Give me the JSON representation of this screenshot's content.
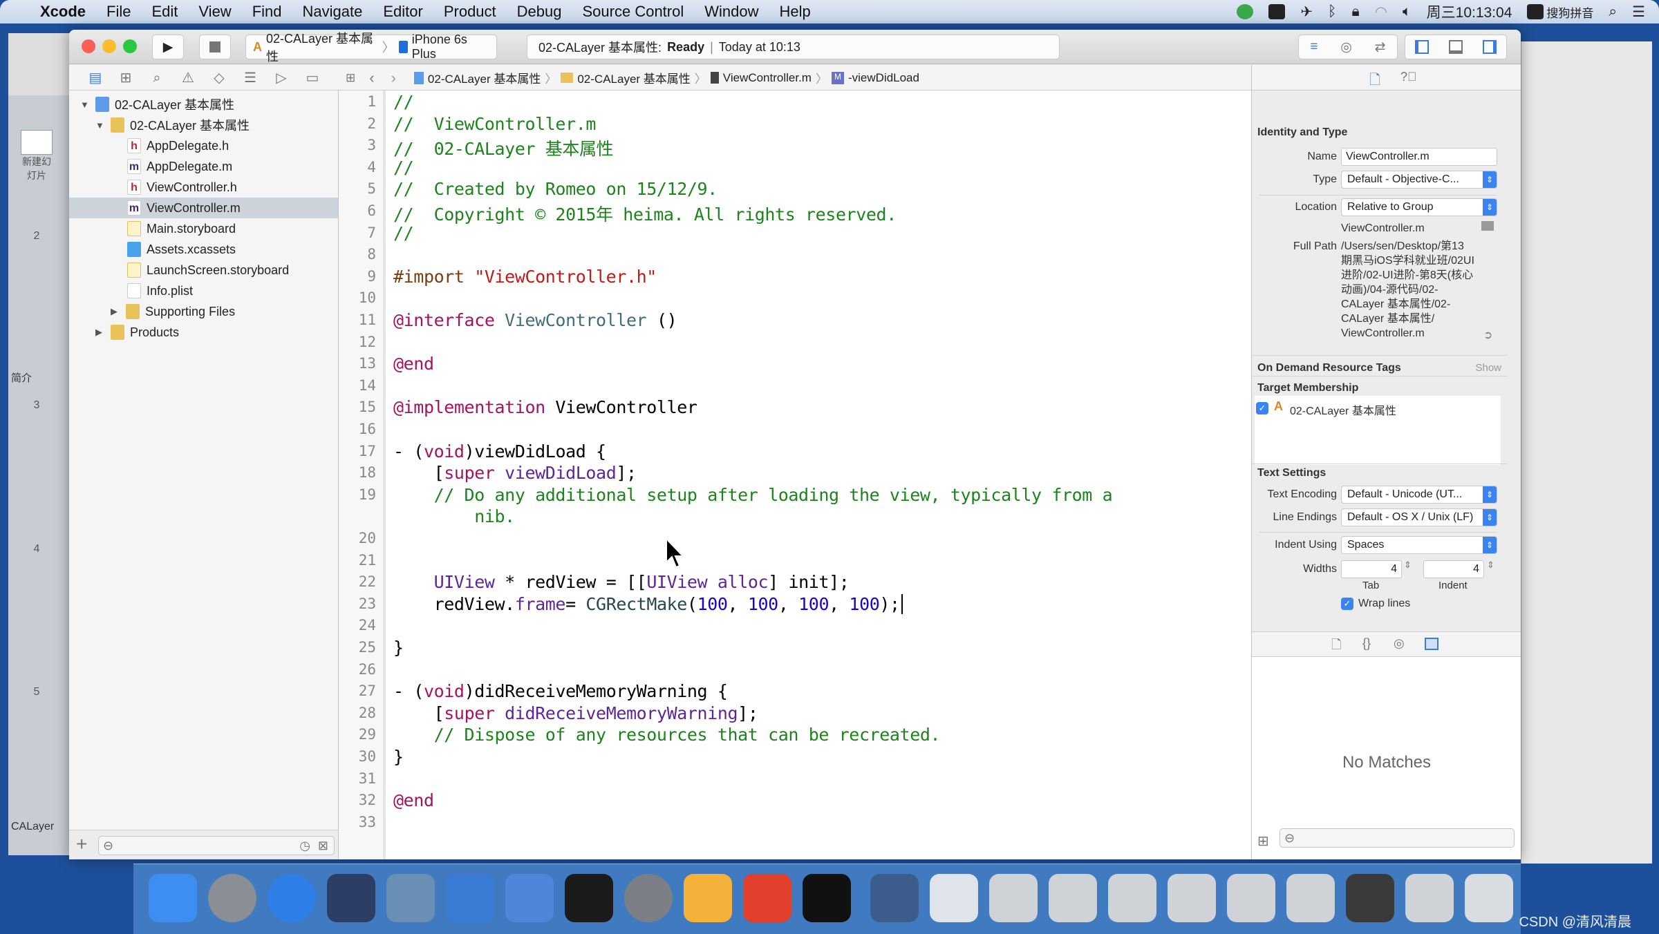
{
  "menubar": {
    "apple": "",
    "items": [
      "Xcode",
      "File",
      "Edit",
      "View",
      "Find",
      "Navigate",
      "Editor",
      "Product",
      "Debug",
      "Source Control",
      "Window",
      "Help"
    ],
    "clock": "周三10:13:04",
    "ime": "搜狗拼音",
    "status_icons": [
      "app-icon",
      "camera-icon",
      "airplane-icon",
      "bluetooth-icon",
      "lock-icon",
      "wifi-icon",
      "volume-icon",
      "sogou-icon",
      "spotlight-icon",
      "notification-center-icon"
    ]
  },
  "left_app": {
    "new_slide": "新建幻灯片",
    "section1": "简介",
    "section2": "CALayer",
    "slides": [
      "2",
      "3",
      "4",
      "5"
    ]
  },
  "toolbar": {
    "scheme": "02-CALayer 基本属性",
    "device": "iPhone 6s Plus",
    "status_project": "02-CALayer 基本属性:",
    "status_state": "Ready",
    "status_sep": "|",
    "status_time": "Today at 10:13"
  },
  "jumpbar": [
    "02-CALayer 基本属性",
    "02-CALayer 基本属性",
    "ViewController.m",
    "-viewDidLoad"
  ],
  "navigator": {
    "items": [
      {
        "label": "02-CALayer 基本属性",
        "type": "proj",
        "level": 0,
        "tri": "▼"
      },
      {
        "label": "02-CALayer 基本属性",
        "type": "folder",
        "level": 1,
        "tri": "▼"
      },
      {
        "label": "AppDelegate.h",
        "type": "hfile",
        "level": 2,
        "glyph": "h"
      },
      {
        "label": "AppDelegate.m",
        "type": "mfile",
        "level": 2,
        "glyph": "m"
      },
      {
        "label": "ViewController.h",
        "type": "hfile",
        "level": 2,
        "glyph": "h"
      },
      {
        "label": "ViewController.m",
        "type": "mfile",
        "level": 2,
        "glyph": "m",
        "selected": true
      },
      {
        "label": "Main.storyboard",
        "type": "sbfile",
        "level": 2
      },
      {
        "label": "Assets.xcassets",
        "type": "xcfile",
        "level": 2
      },
      {
        "label": "LaunchScreen.storyboard",
        "type": "sbfile",
        "level": 2
      },
      {
        "label": "Info.plist",
        "type": "plist",
        "level": 2
      },
      {
        "label": "Supporting Files",
        "type": "folder",
        "level": 2,
        "tri": "▶"
      },
      {
        "label": "Products",
        "type": "folder",
        "level": 1,
        "tri": "▶"
      }
    ]
  },
  "editor": {
    "lines": [
      [
        [
          "//",
          "com"
        ]
      ],
      [
        [
          "//  ViewController.m",
          "com"
        ]
      ],
      [
        [
          "//  02-CALayer 基本属性",
          "com"
        ]
      ],
      [
        [
          "//",
          "com"
        ]
      ],
      [
        [
          "//  Created by Romeo on 15/12/9.",
          "com"
        ]
      ],
      [
        [
          "//  Copyright © 2015年 heima. All rights reserved.",
          "com"
        ]
      ],
      [
        [
          "//",
          "com"
        ]
      ],
      [],
      [
        [
          "#import ",
          "pp"
        ],
        [
          "\"ViewController.h\"",
          "str"
        ]
      ],
      [],
      [
        [
          "@interface ",
          "kw"
        ],
        [
          "ViewController",
          "cls"
        ],
        [
          " ()",
          ""
        ]
      ],
      [],
      [
        [
          "@end",
          "kw"
        ]
      ],
      [],
      [
        [
          "@implementation ",
          "kw"
        ],
        [
          "ViewController",
          ""
        ]
      ],
      [],
      [
        [
          "- (",
          ""
        ],
        [
          "void",
          "kw"
        ],
        [
          ")viewDidLoad {",
          ""
        ]
      ],
      [
        [
          "    [",
          ""
        ],
        [
          "super",
          "kw"
        ],
        [
          " viewDidLoad",
          "uik"
        ],
        [
          "];",
          ""
        ]
      ],
      [
        [
          "    // Do any additional setup after loading the view, typically from a",
          "com"
        ]
      ],
      [],
      [],
      [
        [
          "    ",
          ""
        ],
        [
          "UIView",
          "uik"
        ],
        [
          " * redView = [[",
          ""
        ],
        [
          "UIView",
          "uik"
        ],
        [
          " alloc",
          "uik"
        ],
        [
          "] init];",
          ""
        ]
      ],
      [
        [
          "    redView.",
          ""
        ],
        [
          "frame",
          "uik"
        ],
        [
          "= ",
          ""
        ],
        [
          "CGRectMake",
          "fn"
        ],
        [
          "(",
          ""
        ],
        [
          "100",
          "num"
        ],
        [
          ", ",
          ""
        ],
        [
          "100",
          "num"
        ],
        [
          ", ",
          ""
        ],
        [
          "100",
          "num"
        ],
        [
          ", ",
          ""
        ],
        [
          "100",
          "num"
        ],
        [
          ");",
          ""
        ]
      ],
      [],
      [
        [
          "}",
          ""
        ]
      ],
      [],
      [
        [
          "- (",
          ""
        ],
        [
          "void",
          "kw"
        ],
        [
          ")didReceiveMemoryWarning {",
          ""
        ]
      ],
      [
        [
          "    [",
          ""
        ],
        [
          "super",
          "kw"
        ],
        [
          " didReceiveMemoryWarning",
          "uik"
        ],
        [
          "];",
          ""
        ]
      ],
      [
        [
          "    // Dispose of any resources that can be recreated.",
          "com"
        ]
      ],
      [
        [
          "}",
          ""
        ]
      ],
      [],
      [
        [
          "@end",
          "kw"
        ]
      ],
      []
    ],
    "wrap_line_19": "        nib."
  },
  "inspector": {
    "identity_title": "Identity and Type",
    "name_label": "Name",
    "name_value": "ViewController.m",
    "type_label": "Type",
    "type_value": "Default - Objective-C...",
    "location_label": "Location",
    "location_value": "Relative to Group",
    "location_file": "ViewController.m",
    "fullpath_label": "Full Path",
    "fullpath_lines": [
      "/Users/sen/Desktop/第13",
      "期黑马iOS学科就业班/02UI",
      "进阶/02-UI进阶-第8天(核心",
      "动画)/04-源代码/02-",
      "CALayer 基本属性/02-",
      "CALayer 基本属性/",
      "ViewController.m"
    ],
    "odr_title": "On Demand Resource Tags",
    "odr_show": "Show",
    "target_title": "Target Membership",
    "target_item": "02-CALayer 基本属性",
    "target_checked": true,
    "text_title": "Text Settings",
    "encoding_label": "Text Encoding",
    "encoding_value": "Default - Unicode (UT...",
    "endings_label": "Line Endings",
    "endings_value": "Default - OS X / Unix (LF)",
    "indent_label": "Indent Using",
    "indent_value": "Spaces",
    "widths_label": "Widths",
    "tab_value": "4",
    "indent_width_value": "4",
    "tab_caption": "Tab",
    "indent_caption": "Indent",
    "wrap_label": "Wrap lines",
    "wrap_checked": true,
    "no_matches": "No Matches"
  },
  "dock": {
    "apps": [
      {
        "name": "finder",
        "color": "#3d8ef0"
      },
      {
        "name": "launchpad",
        "color": "#8a8f96"
      },
      {
        "name": "safari",
        "color": "#2f7fe8"
      },
      {
        "name": "mouse-app",
        "color": "#2d3e66"
      },
      {
        "name": "photo-slideshow",
        "color": "#6a8fb5"
      },
      {
        "name": "xcode",
        "color": "#3a7bd5"
      },
      {
        "name": "instruments",
        "color": "#4f86d9"
      },
      {
        "name": "terminal",
        "color": "#1b1b1b"
      },
      {
        "name": "system-preferences",
        "color": "#7c7f85"
      },
      {
        "name": "sketch",
        "color": "#f5b23a"
      },
      {
        "name": "presentation",
        "color": "#e0402c"
      },
      {
        "name": "console",
        "color": "#111111"
      },
      {
        "name": "quicktime",
        "color": "#3c5d8c"
      },
      {
        "name": "preview",
        "color": "#dfe3ea"
      },
      {
        "name": "screenshot-1",
        "color": "#cfd2d6"
      },
      {
        "name": "screenshot-2",
        "color": "#cfd2d6"
      },
      {
        "name": "screenshot-3",
        "color": "#cfd2d6"
      },
      {
        "name": "screenshot-4",
        "color": "#cfd2d6"
      },
      {
        "name": "screenshot-5",
        "color": "#cfd2d6"
      },
      {
        "name": "screenshot-6",
        "color": "#cfd2d6"
      },
      {
        "name": "screenshot-7",
        "color": "#3a3a3a"
      },
      {
        "name": "screenshot-8",
        "color": "#cfd2d6"
      },
      {
        "name": "trash",
        "color": "#d9dde2"
      }
    ]
  },
  "watermark": "CSDN @清风清晨"
}
